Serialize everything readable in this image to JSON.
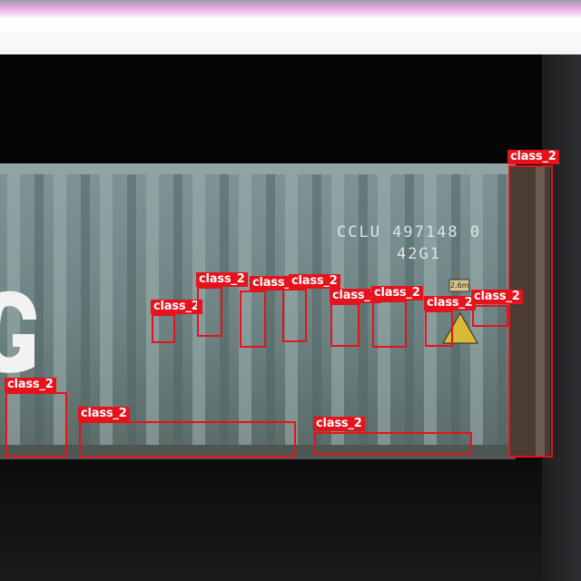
{
  "container": {
    "code_line1": "CCLU 497148 0",
    "code_line2": "42G1",
    "height_mark": "2.6m"
  },
  "detections": [
    {
      "label": "class_2"
    },
    {
      "label": "class_2"
    },
    {
      "label": "class_2"
    },
    {
      "label": "class_2"
    },
    {
      "label": "class_2"
    },
    {
      "label": "class_2"
    },
    {
      "label": "class_2"
    },
    {
      "label": "class_2"
    },
    {
      "label": "class_2"
    },
    {
      "label": "class_2"
    },
    {
      "label": "class_2"
    },
    {
      "label": "class_2"
    },
    {
      "label": "class_2"
    }
  ]
}
